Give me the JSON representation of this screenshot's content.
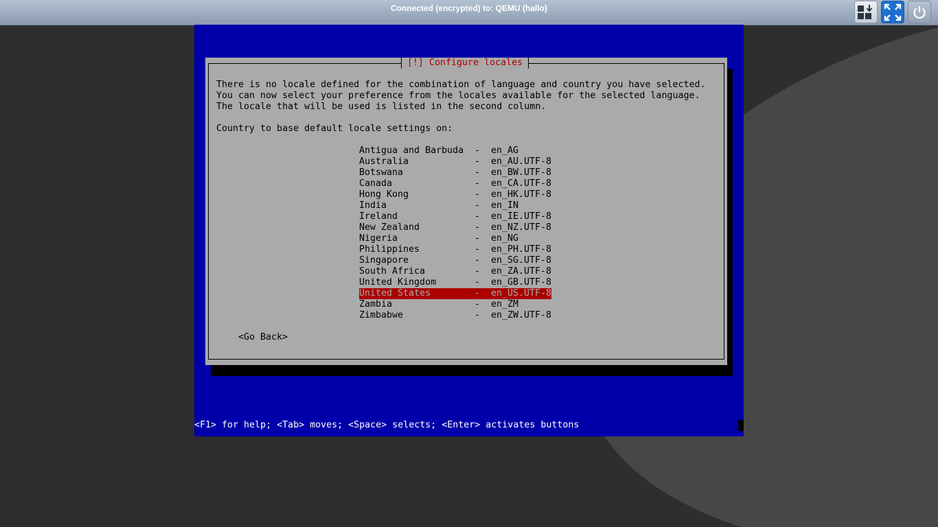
{
  "viewer": {
    "title": "Connected (encrypted) to: QEMU (hallo)",
    "buttons": {
      "send_keys_icon": "keyboard-keys-icon",
      "fullscreen_icon": "fullscreen-icon",
      "power_icon": "power-icon"
    }
  },
  "installer": {
    "dialog_title": "[!] Configure locales",
    "description": "There is no locale defined for the combination of language and country you have selected.\nYou can now select your preference from the locales available for the selected language.\nThe locale that will be used is listed in the second column.",
    "prompt": "Country to base default locale settings on:",
    "locales": [
      {
        "country": "Antigua and Barbuda",
        "dash": "-",
        "locale": "en_AG"
      },
      {
        "country": "Australia",
        "dash": "-",
        "locale": "en_AU.UTF-8"
      },
      {
        "country": "Botswana",
        "dash": "-",
        "locale": "en_BW.UTF-8"
      },
      {
        "country": "Canada",
        "dash": "-",
        "locale": "en_CA.UTF-8"
      },
      {
        "country": "Hong Kong",
        "dash": "-",
        "locale": "en_HK.UTF-8"
      },
      {
        "country": "India",
        "dash": "-",
        "locale": "en_IN"
      },
      {
        "country": "Ireland",
        "dash": "-",
        "locale": "en_IE.UTF-8"
      },
      {
        "country": "New Zealand",
        "dash": "-",
        "locale": "en_NZ.UTF-8"
      },
      {
        "country": "Nigeria",
        "dash": "-",
        "locale": "en_NG"
      },
      {
        "country": "Philippines",
        "dash": "-",
        "locale": "en_PH.UTF-8"
      },
      {
        "country": "Singapore",
        "dash": "-",
        "locale": "en_SG.UTF-8"
      },
      {
        "country": "South Africa",
        "dash": "-",
        "locale": "en_ZA.UTF-8"
      },
      {
        "country": "United Kingdom",
        "dash": "-",
        "locale": "en_GB.UTF-8"
      },
      {
        "country": "United States",
        "dash": "-",
        "locale": "en_US.UTF-8"
      },
      {
        "country": "Zambia",
        "dash": "-",
        "locale": "en_ZM"
      },
      {
        "country": "Zimbabwe",
        "dash": "-",
        "locale": "en_ZW.UTF-8"
      }
    ],
    "selected_country": "United States",
    "go_back": "<Go Back>",
    "status_line": "<F1> for help; <Tab> moves; <Space> selects; <Enter> activates buttons"
  },
  "colors": {
    "console_bg": "#0000aa",
    "dialog_bg": "#aaaaaa",
    "title_fg": "#aa0000",
    "selection_bg": "#aa0000"
  }
}
